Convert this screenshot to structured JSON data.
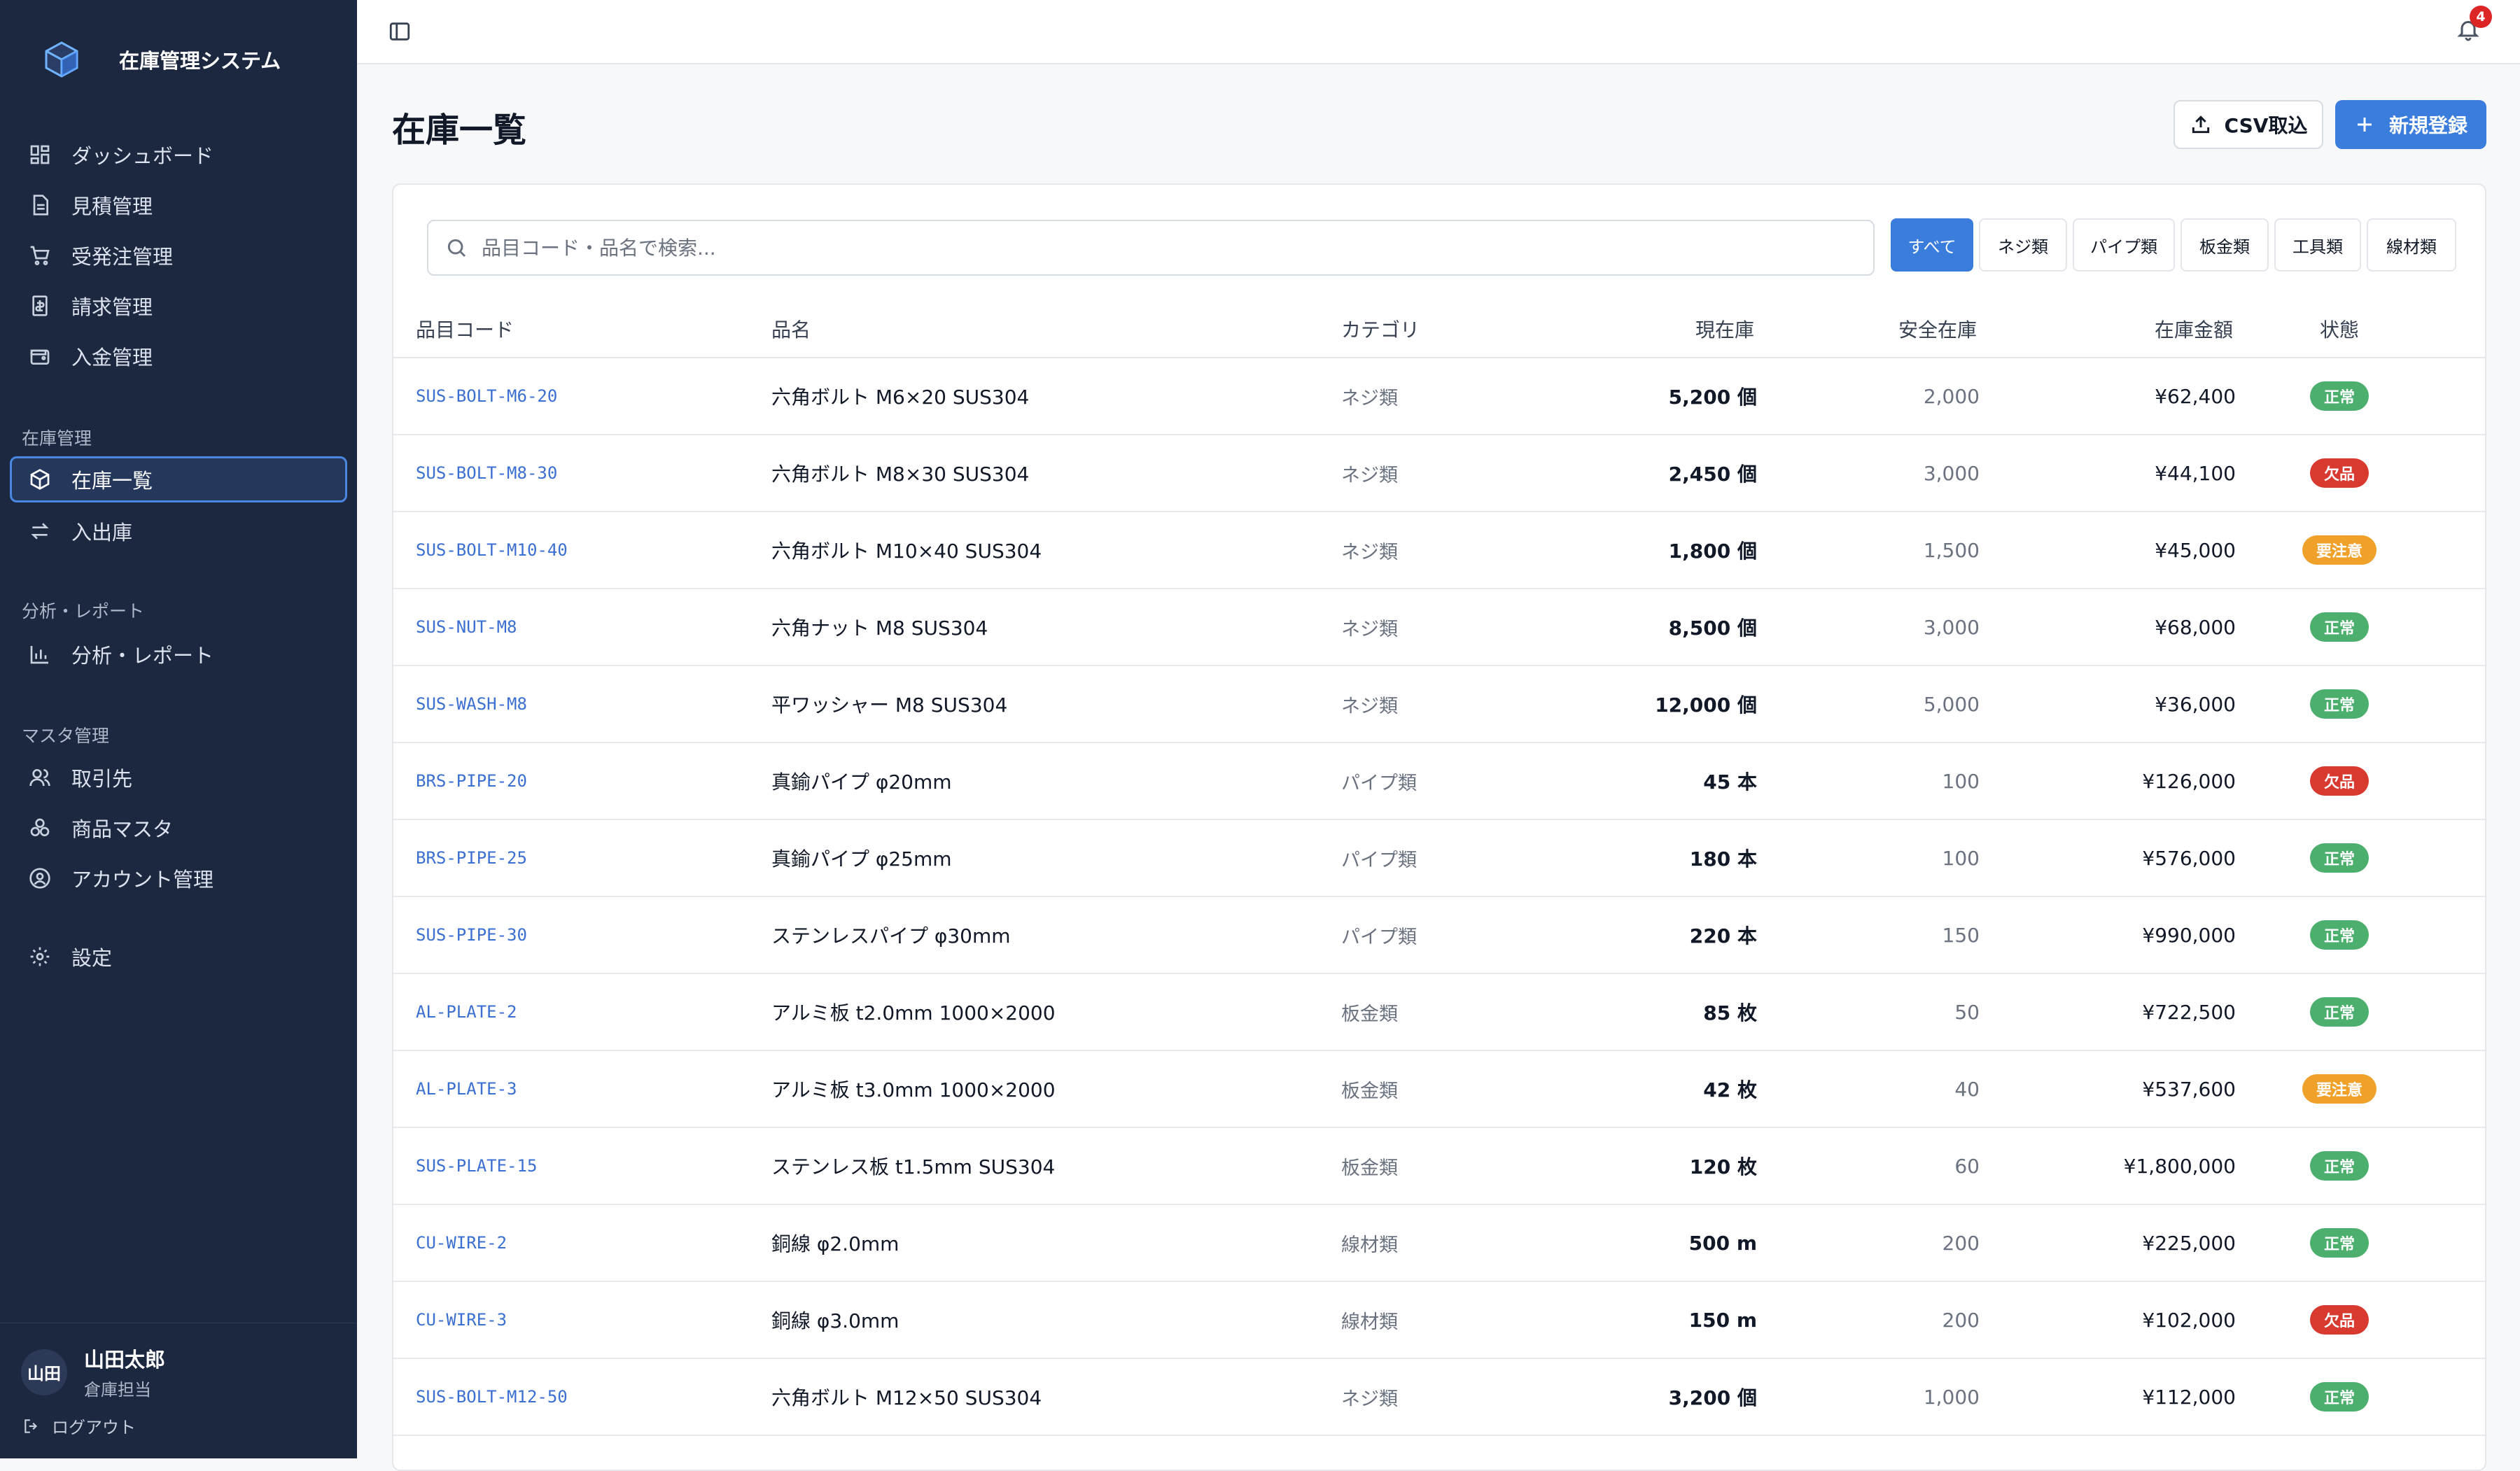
{
  "app": {
    "title": "在庫管理システム"
  },
  "sidebar": {
    "main_items": [
      {
        "label": "ダッシュボード",
        "icon": "dashboard-icon"
      },
      {
        "label": "見積管理",
        "icon": "document-icon"
      },
      {
        "label": "受発注管理",
        "icon": "cart-icon"
      },
      {
        "label": "請求管理",
        "icon": "invoice-icon"
      },
      {
        "label": "入金管理",
        "icon": "wallet-icon"
      }
    ],
    "groups": [
      {
        "label": "在庫管理",
        "items": [
          {
            "label": "在庫一覧",
            "icon": "package-icon",
            "active": true
          },
          {
            "label": "入出庫",
            "icon": "swap-icon"
          }
        ]
      },
      {
        "label": "分析・レポート",
        "items": [
          {
            "label": "分析・レポート",
            "icon": "bar-chart-icon"
          }
        ]
      },
      {
        "label": "マスタ管理",
        "items": [
          {
            "label": "取引先",
            "icon": "users-icon"
          },
          {
            "label": "商品マスタ",
            "icon": "boxes-icon"
          },
          {
            "label": "アカウント管理",
            "icon": "user-circle-icon"
          }
        ]
      }
    ],
    "settings": {
      "label": "設定",
      "icon": "gear-icon"
    },
    "user": {
      "initials": "山田",
      "name": "山田太郎",
      "role": "倉庫担当"
    },
    "logout": "ログアウト"
  },
  "topbar": {
    "notification_count": "4"
  },
  "page": {
    "title": "在庫一覧",
    "csv_button": "CSV取込",
    "new_button": "新規登録"
  },
  "search": {
    "placeholder": "品目コード・品名で検索..."
  },
  "filters": [
    "すべて",
    "ネジ類",
    "パイプ類",
    "板金類",
    "工具類",
    "線材類"
  ],
  "filter_active_index": 0,
  "table": {
    "columns": {
      "code": "品目コード",
      "name": "品名",
      "category": "カテゴリ",
      "quantity": "現在庫",
      "safety": "安全在庫",
      "amount": "在庫金額",
      "status": "状態"
    },
    "rows": [
      {
        "code": "SUS-BOLT-M6-20",
        "name": "六角ボルト M6×20 SUS304",
        "category": "ネジ類",
        "quantity": "5,200 個",
        "safety": "2,000",
        "amount": "¥62,400",
        "status": "正常"
      },
      {
        "code": "SUS-BOLT-M8-30",
        "name": "六角ボルト M8×30 SUS304",
        "category": "ネジ類",
        "quantity": "2,450 個",
        "safety": "3,000",
        "amount": "¥44,100",
        "status": "欠品"
      },
      {
        "code": "SUS-BOLT-M10-40",
        "name": "六角ボルト M10×40 SUS304",
        "category": "ネジ類",
        "quantity": "1,800 個",
        "safety": "1,500",
        "amount": "¥45,000",
        "status": "要注意"
      },
      {
        "code": "SUS-NUT-M8",
        "name": "六角ナット M8 SUS304",
        "category": "ネジ類",
        "quantity": "8,500 個",
        "safety": "3,000",
        "amount": "¥68,000",
        "status": "正常"
      },
      {
        "code": "SUS-WASH-M8",
        "name": "平ワッシャー M8 SUS304",
        "category": "ネジ類",
        "quantity": "12,000 個",
        "safety": "5,000",
        "amount": "¥36,000",
        "status": "正常"
      },
      {
        "code": "BRS-PIPE-20",
        "name": "真鍮パイプ φ20mm",
        "category": "パイプ類",
        "quantity": "45 本",
        "safety": "100",
        "amount": "¥126,000",
        "status": "欠品"
      },
      {
        "code": "BRS-PIPE-25",
        "name": "真鍮パイプ φ25mm",
        "category": "パイプ類",
        "quantity": "180 本",
        "safety": "100",
        "amount": "¥576,000",
        "status": "正常"
      },
      {
        "code": "SUS-PIPE-30",
        "name": "ステンレスパイプ φ30mm",
        "category": "パイプ類",
        "quantity": "220 本",
        "safety": "150",
        "amount": "¥990,000",
        "status": "正常"
      },
      {
        "code": "AL-PLATE-2",
        "name": "アルミ板 t2.0mm 1000×2000",
        "category": "板金類",
        "quantity": "85 枚",
        "safety": "50",
        "amount": "¥722,500",
        "status": "正常"
      },
      {
        "code": "AL-PLATE-3",
        "name": "アルミ板 t3.0mm 1000×2000",
        "category": "板金類",
        "quantity": "42 枚",
        "safety": "40",
        "amount": "¥537,600",
        "status": "要注意"
      },
      {
        "code": "SUS-PLATE-15",
        "name": "ステンレス板 t1.5mm SUS304",
        "category": "板金類",
        "quantity": "120 枚",
        "safety": "60",
        "amount": "¥1,800,000",
        "status": "正常"
      },
      {
        "code": "CU-WIRE-2",
        "name": "銅線 φ2.0mm",
        "category": "線材類",
        "quantity": "500 m",
        "safety": "200",
        "amount": "¥225,000",
        "status": "正常"
      },
      {
        "code": "CU-WIRE-3",
        "name": "銅線 φ3.0mm",
        "category": "線材類",
        "quantity": "150 m",
        "safety": "200",
        "amount": "¥102,000",
        "status": "欠品"
      },
      {
        "code": "SUS-BOLT-M12-50",
        "name": "六角ボルト M12×50 SUS304",
        "category": "ネジ類",
        "quantity": "3,200 個",
        "safety": "1,000",
        "amount": "¥112,000",
        "status": "正常"
      }
    ]
  },
  "status_colors": {
    "正常": "#4caf6e",
    "欠品": "#d93a30",
    "要注意": "#f0a12a"
  }
}
